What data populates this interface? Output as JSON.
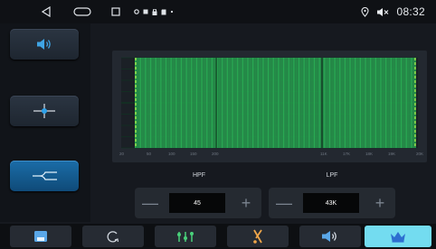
{
  "statusbar": {
    "nav_icons": [
      "back-icon",
      "home-icon",
      "recent-apps-icon"
    ],
    "notification_icons": [
      "settings-icon",
      "image-icon",
      "lock-icon",
      "sdcard-icon",
      "dot-icon"
    ],
    "location_icon": "location-icon",
    "mute_icon": "volume-muted-icon",
    "time": "08:32"
  },
  "left_panel": {
    "buttons": [
      {
        "name": "volume",
        "icon": "speaker-icon",
        "active": false
      },
      {
        "name": "balance",
        "icon": "crosshair-icon",
        "active": false
      },
      {
        "name": "crossover",
        "icon": "crossover-icon",
        "active": true
      }
    ]
  },
  "chart_data": {
    "type": "bar",
    "description_free": true,
    "x_ticks": [
      "20",
      "50",
      "100",
      "150",
      "200",
      "",
      "11K",
      "17K",
      "18K",
      "19K",
      "20K"
    ],
    "bars": 256,
    "hpf_marker_label": "45",
    "lpf_marker_label": "43K",
    "grid": true,
    "colors": {
      "fill": "#29ad54",
      "line": "#a9e548",
      "grid": "#1c2128"
    }
  },
  "filters": {
    "hpf": {
      "title": "HPF",
      "value": "45"
    },
    "lpf": {
      "title": "LPF",
      "value": "43K"
    },
    "minus_symbol": "—",
    "plus_symbol": "+"
  },
  "tabbar": {
    "tabs": [
      {
        "name": "save",
        "icon": "save-icon",
        "active": false
      },
      {
        "name": "reset",
        "icon": "refresh-icon",
        "active": false
      },
      {
        "name": "equalizer",
        "icon": "equalizer-icon",
        "active": false
      },
      {
        "name": "sound",
        "icon": "tuning-icon",
        "active": false
      },
      {
        "name": "speaker",
        "icon": "speaker-icon",
        "active": false
      },
      {
        "name": "premium",
        "icon": "crown-icon",
        "active": true
      }
    ],
    "active_color": "#73dcf0"
  }
}
